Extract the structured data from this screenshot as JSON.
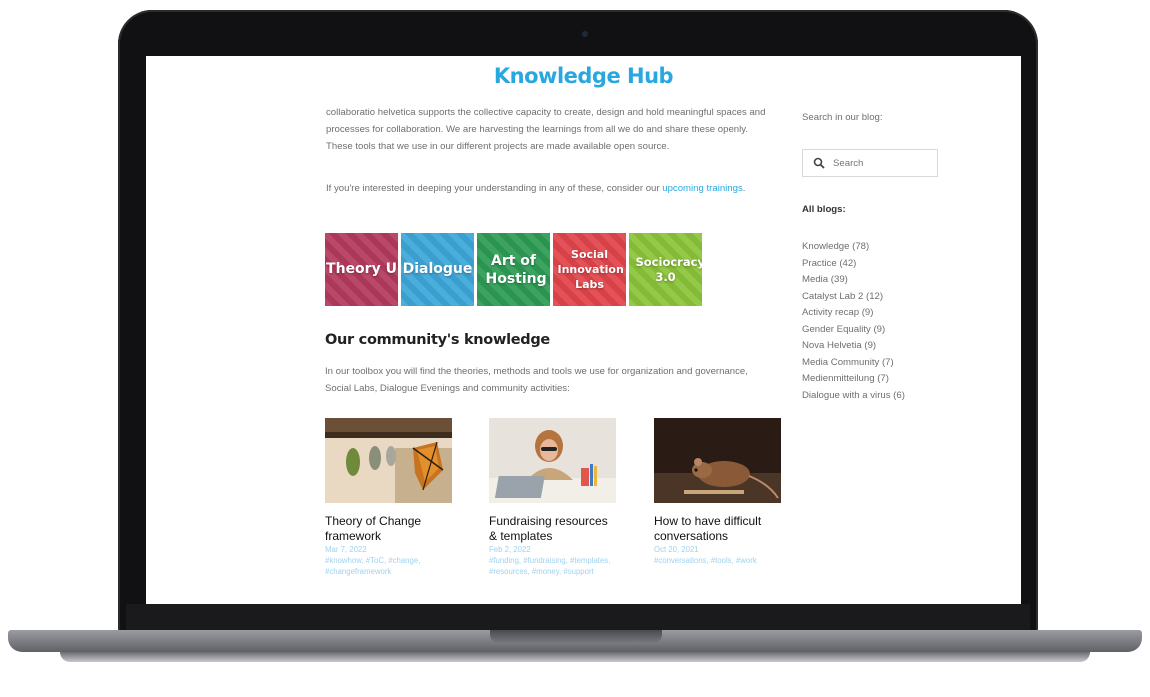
{
  "page": {
    "title": "Knowledge Hub",
    "intro": "collaboratio helvetica supports the collective capacity to create, design and hold meaningful spaces and processes for collaboration. We are harvesting the learnings from all we do and share these openly. These tools that we use in our different projects are made available open source.",
    "intro2_prefix": "If you're interested in deeping your understanding in any of these, consider our ",
    "intro2_link": "upcoming trainings",
    "intro2_suffix": "."
  },
  "tiles": [
    {
      "label": "Theory U",
      "color": "#b43a5e"
    },
    {
      "label": "Dialogue",
      "color": "#3da7d9"
    },
    {
      "label": "Art of Hosting",
      "color": "#2e9c55"
    },
    {
      "label": "Social Innovation Labs",
      "color": "#e2454c"
    },
    {
      "label": "Sociocracy 3.0",
      "color": "#8cc43a"
    }
  ],
  "section": {
    "title": "Our community's knowledge",
    "text": "In our toolbox you will find the theories, methods and tools we use for organization and governance, Social Labs, Dialogue Evenings and community activities:"
  },
  "cards": [
    {
      "title": "Theory of Change framework",
      "date": "Mar 7, 2022",
      "tags": "#knowhow, #ToC, #change, #changeframework"
    },
    {
      "title": "Fundraising resources & templates",
      "date": "Feb 2, 2022",
      "tags": "#funding, #fundraising, #templates, #resources, #money, #support"
    },
    {
      "title": "How to have difficult conversations",
      "date": "Oct 20, 2021",
      "tags": "#conversations, #tools, #work"
    }
  ],
  "sidebar": {
    "search_label": "Search in our blog:",
    "search_placeholder": "Search",
    "all_blogs_label": "All blogs:",
    "blogs": [
      "Knowledge (78)",
      "Practice (42)",
      "Media (39)",
      "Catalyst Lab 2 (12)",
      "Activity recap (9)",
      "Gender Equality (9)",
      "Nova Helvetia (9)",
      "Media Community (7)",
      "Medienmitteilung (7)",
      "Dialogue with a virus (6)"
    ]
  },
  "colors": {
    "accent": "#29a8e0"
  }
}
